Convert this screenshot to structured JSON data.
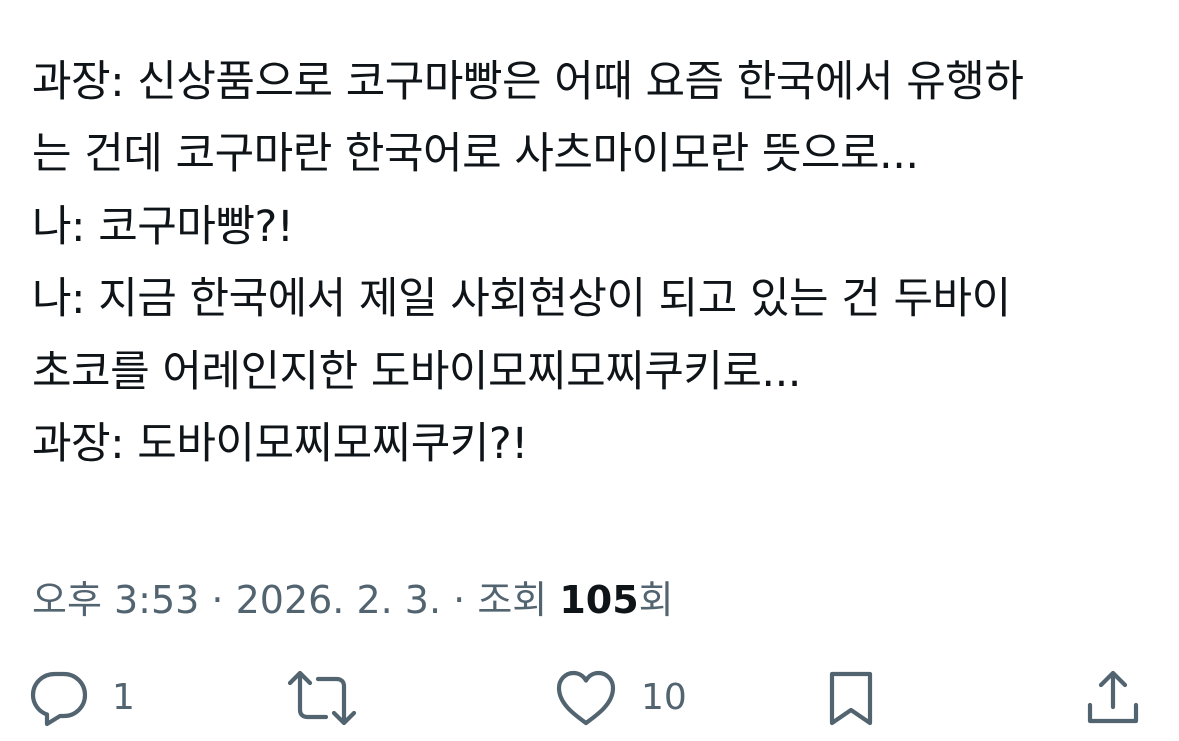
{
  "tweet": {
    "lines": [
      "과장: 신상품으로 코구마빵은 어때 요즘 한국에서 유행하",
      "는 건데 코구마란 한국어로 사츠마이모란 뜻으로...",
      "나: 코구마빵?!",
      "나: 지금 한국에서 제일 사회현상이 되고 있는 건 두바이",
      "초코를 어레인지한 도바이모찌모찌쿠키로...",
      "과장: 도바이모찌모찌쿠키?!"
    ]
  },
  "meta": {
    "time": "오후 3:53",
    "separator": " · ",
    "date": "2026. 2. 3.",
    "views_label": "조회 ",
    "views_count": "105",
    "views_suffix": "회"
  },
  "actions": {
    "reply": {
      "icon": "reply-icon",
      "count": "1"
    },
    "retweet": {
      "icon": "retweet-icon",
      "count": ""
    },
    "like": {
      "icon": "heart-icon",
      "count": "10"
    },
    "bookmark": {
      "icon": "bookmark-icon"
    },
    "share": {
      "icon": "share-icon"
    }
  },
  "colors": {
    "text": "#0f1419",
    "secondary": "#536471",
    "background": "#ffffff"
  }
}
